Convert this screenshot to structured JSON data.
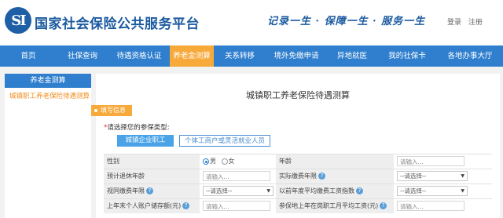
{
  "header": {
    "logo_text": "SI",
    "title": "国家社会保险公共服务平台",
    "slogan": "记录一生 · 保障一生 · 服务一生",
    "login": "登录",
    "register": "注册"
  },
  "nav": {
    "items": [
      "首页",
      "社保查询",
      "待遇资格认证",
      "养老金测算",
      "关系转移",
      "境外免缴申请",
      "异地就医",
      "我的社保卡",
      "各地办事大厅"
    ],
    "active_index": 3
  },
  "sidebar": {
    "heading": "养老金测算",
    "items": [
      "城镇职工养老保险待遇测算"
    ]
  },
  "main": {
    "title": "城镇职工养老保险待遇测算",
    "section_tag": "填写信息",
    "prompt_required": "*",
    "prompt": "请选择您的参保类型:",
    "type_buttons": [
      "城镇企业职工",
      "个体工商户或灵活就业人员"
    ],
    "form": {
      "gender_label": "性别",
      "gender_male": "男",
      "gender_female": "女",
      "age_label": "年龄",
      "age_placeholder": "请输入...",
      "retire_age_label": "预计退休年龄",
      "retire_age_placeholder": "请输入...",
      "actual_years_label": "实际缴费年限",
      "actual_years_value": "--请选择--",
      "deemed_years_label": "视同缴费年限",
      "deemed_years_value": "--请选择--",
      "avg_index_label": "以前年度平均缴费工资指数",
      "avg_index_value": "--请选择--",
      "balance_label": "上年末个人账户储存额(元)",
      "balance_placeholder": "请输入...",
      "avg_wage_label": "参保地上年在岗职工月平均工资(元)",
      "avg_wage_placeholder": "请输入..."
    }
  },
  "colors": {
    "brand_blue": "#1b5aa0",
    "nav_blue": "#2f7fce",
    "accent_orange": "#f7a93a",
    "button_blue": "#4aa3e6"
  }
}
